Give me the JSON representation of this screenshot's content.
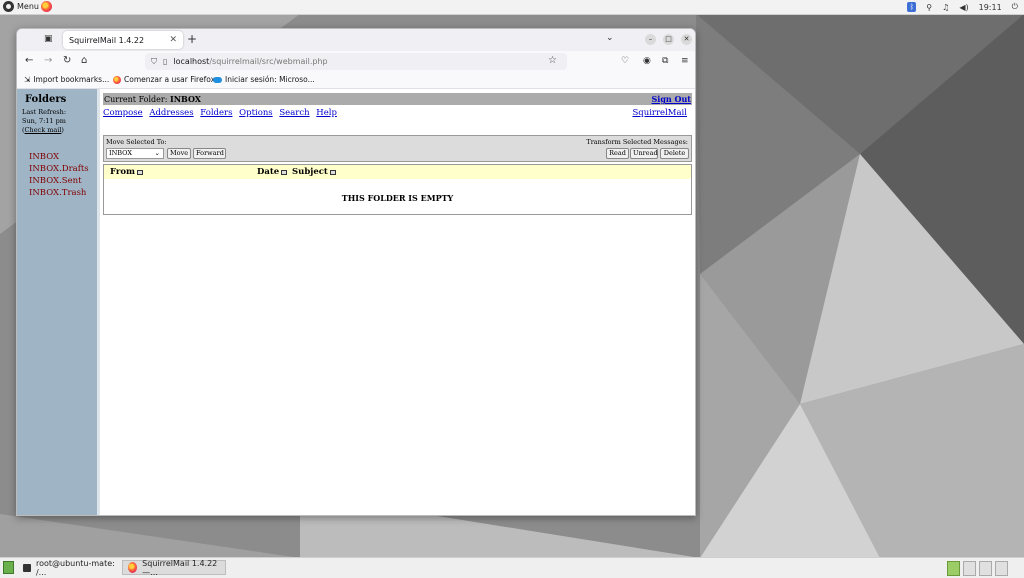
{
  "top_panel": {
    "menu_label": "Menu",
    "clock": "19:11"
  },
  "taskbar": {
    "terminal_task": "root@ubuntu-mate: /...",
    "firefox_task": "SquirrelMail 1.4.22 —..."
  },
  "browser": {
    "tab_title": "SquirrelMail 1.4.22",
    "url_host": "localhost",
    "url_path": "/squirrelmail/src/webmail.php",
    "bookmarks": [
      {
        "label": "Import bookmarks..."
      },
      {
        "label": "Comenzar a usar Firefox"
      },
      {
        "label": "Iniciar sesión: Microso..."
      }
    ]
  },
  "left_pane": {
    "title": "Folders",
    "last_refresh_label": "Last Refresh:",
    "last_refresh_time": "Sun, 7:11 pm",
    "check_mail": "Check mail",
    "folders": [
      {
        "name": "INBOX"
      },
      {
        "name": "INBOX.Drafts"
      },
      {
        "name": "INBOX.Sent"
      },
      {
        "name": "INBOX.Trash"
      }
    ]
  },
  "main": {
    "current_folder_label": "Current Folder:",
    "current_folder": "INBOX",
    "sign_out": "Sign Out",
    "menu": [
      {
        "label": "Compose"
      },
      {
        "label": "Addresses"
      },
      {
        "label": "Folders"
      },
      {
        "label": "Options"
      },
      {
        "label": "Search"
      },
      {
        "label": "Help"
      }
    ],
    "squirrelmail_link": "SquirrelMail",
    "move_selected_label": "Move Selected To:",
    "transform_label": "Transform Selected Messages:",
    "folder_select_value": "INBOX",
    "buttons": {
      "move": "Move",
      "forward": "Forward",
      "read": "Read",
      "unread": "Unread",
      "delete": "Delete"
    },
    "columns": {
      "from": "From",
      "date": "Date",
      "subject": "Subject"
    },
    "empty_message": "THIS FOLDER IS EMPTY"
  },
  "colors": {
    "left_pane_bg": "#9fb5c6",
    "folder_link": "#800000",
    "link": "#0000cc",
    "header_row_bg": "#ffffcc",
    "current_folder_bar": "#ababab"
  }
}
